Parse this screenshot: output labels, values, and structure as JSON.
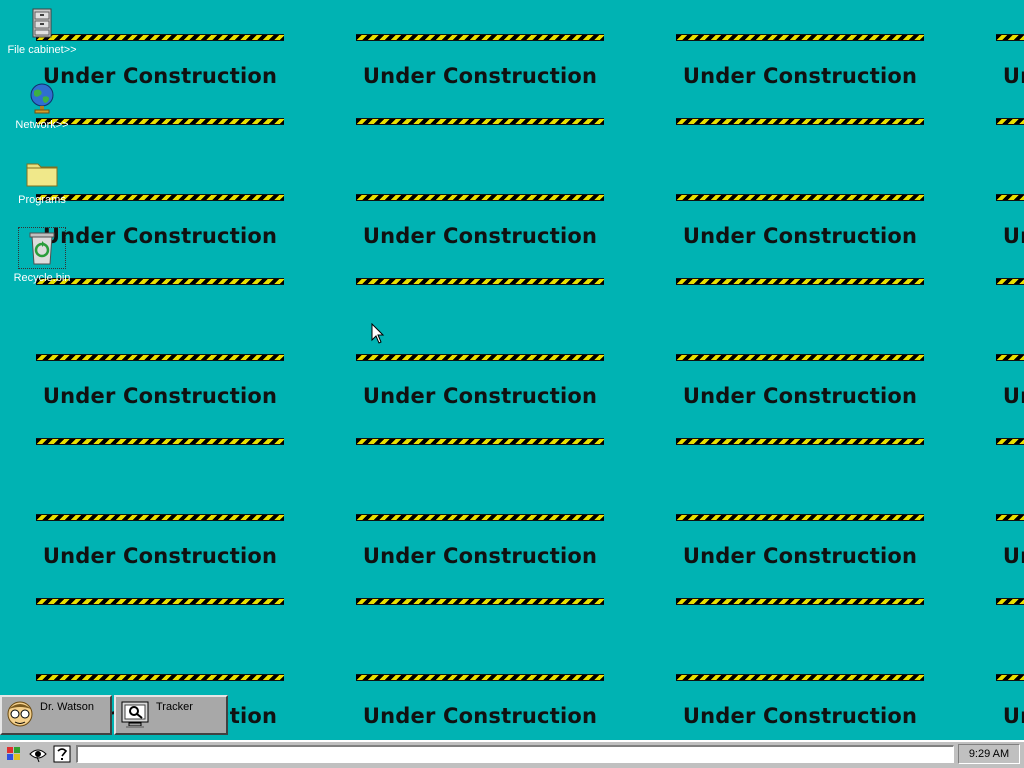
{
  "wallpaper": {
    "tile_text": "Under Construction"
  },
  "desktop_icons": [
    {
      "label": "File cabinet>>",
      "icon": "file-cabinet-icon"
    },
    {
      "label": "Network>>",
      "icon": "network-globe-icon"
    },
    {
      "label": "Programs",
      "icon": "folder-icon"
    },
    {
      "label": "Recycle.bin",
      "icon": "recycle-bin-icon"
    }
  ],
  "floating_buttons": [
    {
      "label": "Dr. Watson",
      "icon": "dr-watson-icon"
    },
    {
      "label": "Tracker",
      "icon": "tracker-icon"
    }
  ],
  "taskbar": {
    "tray_icons": [
      "windows-flag-icon",
      "eye-icon",
      "help-icon"
    ],
    "command_value": "",
    "clock": "9:29 AM"
  },
  "colors": {
    "desktop": "#00b3b3",
    "stripe_yellow": "#e8e000",
    "taskbar": "#c0c0c0"
  }
}
